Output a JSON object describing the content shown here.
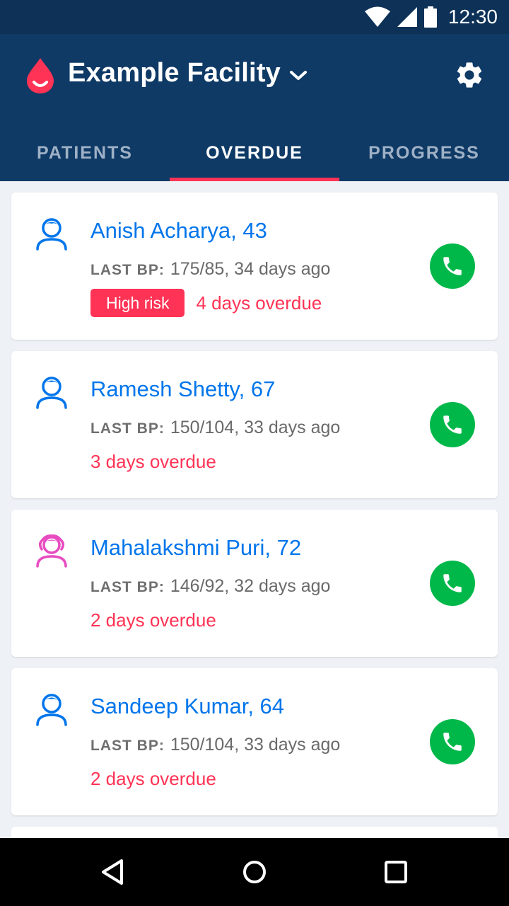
{
  "status_bar": {
    "time": "12:30"
  },
  "header": {
    "facility_name": "Example Facility",
    "tabs": [
      {
        "label": "PATIENTS",
        "active": false
      },
      {
        "label": "OVERDUE",
        "active": true
      },
      {
        "label": "PROGRESS",
        "active": false
      }
    ]
  },
  "patients": [
    {
      "name": "Anish Acharya, 43",
      "bp_label": "LAST BP:",
      "bp_value": "175/85, 34 days ago",
      "badge": "High risk",
      "overdue": "4 days overdue",
      "gender": "male"
    },
    {
      "name": "Ramesh Shetty, 67",
      "bp_label": "LAST BP:",
      "bp_value": "150/104, 33 days ago",
      "badge": "",
      "overdue": "3 days overdue",
      "gender": "male"
    },
    {
      "name": "Mahalakshmi Puri, 72",
      "bp_label": "LAST BP:",
      "bp_value": "146/92, 32 days ago",
      "badge": "",
      "overdue": "2 days overdue",
      "gender": "female"
    },
    {
      "name": "Sandeep Kumar, 64",
      "bp_label": "LAST BP:",
      "bp_value": "150/104, 33 days ago",
      "badge": "",
      "overdue": "2 days overdue",
      "gender": "male"
    }
  ],
  "colors": {
    "primary_dark": "#0d3157",
    "app_bar": "#0f3a66",
    "accent_red": "#ff3355",
    "link_blue": "#0075eb",
    "call_green": "#00b849",
    "female_pink": "#e84bc0"
  },
  "icons": {
    "logo": "blood-drop-icon",
    "dropdown": "chevron-down-icon",
    "settings": "gear-icon",
    "avatar_male": "male-patient-icon",
    "avatar_female": "female-patient-icon",
    "call": "phone-icon",
    "nav_back": "back-triangle-icon",
    "nav_home": "home-circle-icon",
    "nav_recents": "recents-square-icon"
  }
}
